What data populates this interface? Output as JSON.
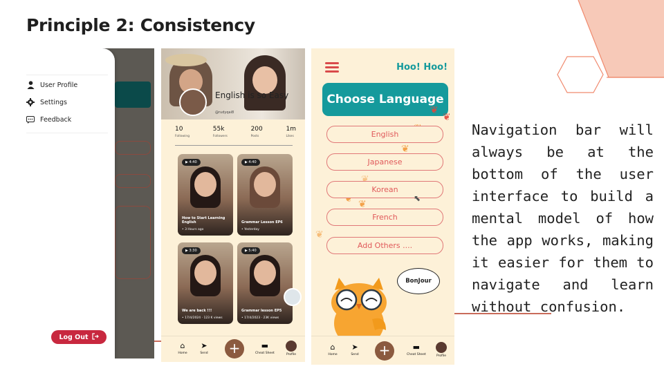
{
  "slide": {
    "title": "Principle 2: Consistency",
    "description": "Navigation bar will always be at the bottom of the user interface to build a mental model of how the app works, making it easier for them to navigate and learn without confusion."
  },
  "colors": {
    "hexagon": "#f7c9b8",
    "accent_red": "#c8283f",
    "teal": "#159a9c",
    "cream": "#fdf1d8"
  },
  "panel1": {
    "menu": [
      {
        "label": "User Profile",
        "icon": "user-icon"
      },
      {
        "label": "Settings",
        "icon": "gear-icon"
      },
      {
        "label": "Feedback",
        "icon": "feedback-icon"
      }
    ],
    "logout_label": "Log Out"
  },
  "panel2": {
    "headline": "English is so Easy",
    "handle": "@rudyqai8",
    "stats": [
      {
        "value": "10",
        "label": "Following"
      },
      {
        "value": "55k",
        "label": "Followers"
      },
      {
        "value": "200",
        "label": "Posts"
      },
      {
        "value": "1m",
        "label": "Likes"
      }
    ],
    "cards": [
      {
        "badge": "▶ 4:40",
        "title": "How to Start Learning English",
        "meta": "• 3 Hours ago"
      },
      {
        "badge": "▶ 4:40",
        "title": "Grammar Lesson EP6",
        "meta": "• Yesterday"
      },
      {
        "badge": "▶ 3:30",
        "title": "We are back !!!",
        "meta": "• 17/4/2024 · 123 K views"
      },
      {
        "badge": "▶ 5:40",
        "title": "Grammar lesson EP5",
        "meta": "• 17/4/2023 · 23K views"
      }
    ]
  },
  "navbar": {
    "home": "Home",
    "send": "Send",
    "plus": "+",
    "cheat": "Cheat Sheet",
    "profile": "Profile"
  },
  "panel3": {
    "greeting": "Hoo! Hoo!",
    "choose_label": "Choose Language",
    "languages": [
      "English",
      "Japanese",
      "Korean",
      "French",
      "Add Others ...."
    ],
    "bubble": "BonJour"
  }
}
